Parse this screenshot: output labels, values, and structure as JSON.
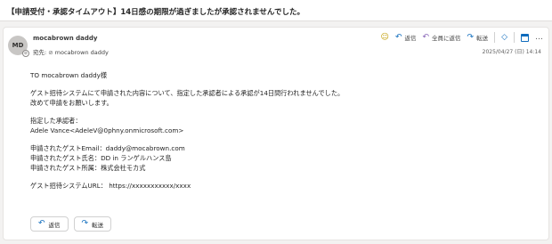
{
  "subject": "【申請受付・承認タイムアウト】14日感の期限が過ぎましたが承認されませんでした。",
  "sender": {
    "initials": "MD",
    "name": "mocabrown daddy",
    "to_label": "宛先:",
    "to_name": "mocabrown daddy"
  },
  "actions": {
    "reply": "返信",
    "reply_all": "全員に返信",
    "forward": "転送",
    "more": "…"
  },
  "timestamp": "2025/04/27 (日) 14:14",
  "body": {
    "greeting": "TO mocabrown daddy様",
    "line1": "ゲスト招待システムにて申請された内容について、指定した承認者による承認が14日間行われませんでした。",
    "line2": "改めて申請をお願いします。",
    "approver_label": "指定した承認者：",
    "approver_value": "Adele Vance<AdeleV@0phny.onmicrosoft.com>",
    "guest_email": "申請されたゲストEmail：daddy@mocabrown.com",
    "guest_name": "申請されたゲスト氏名：DD in ランゲルハンス島",
    "guest_company": "申請されたゲスト所属：株式会社モカ式",
    "system_url": "ゲスト招待システムURL： https://xxxxxxxxxxx/xxxx"
  },
  "reply_buttons": {
    "reply": "返信",
    "forward": "転送"
  },
  "colors": {
    "accent": "#0f6cbd",
    "reply_all_icon": "#8764b8",
    "emoji_icon": "#c19c00",
    "avatar_bg": "#c8c6c4"
  }
}
